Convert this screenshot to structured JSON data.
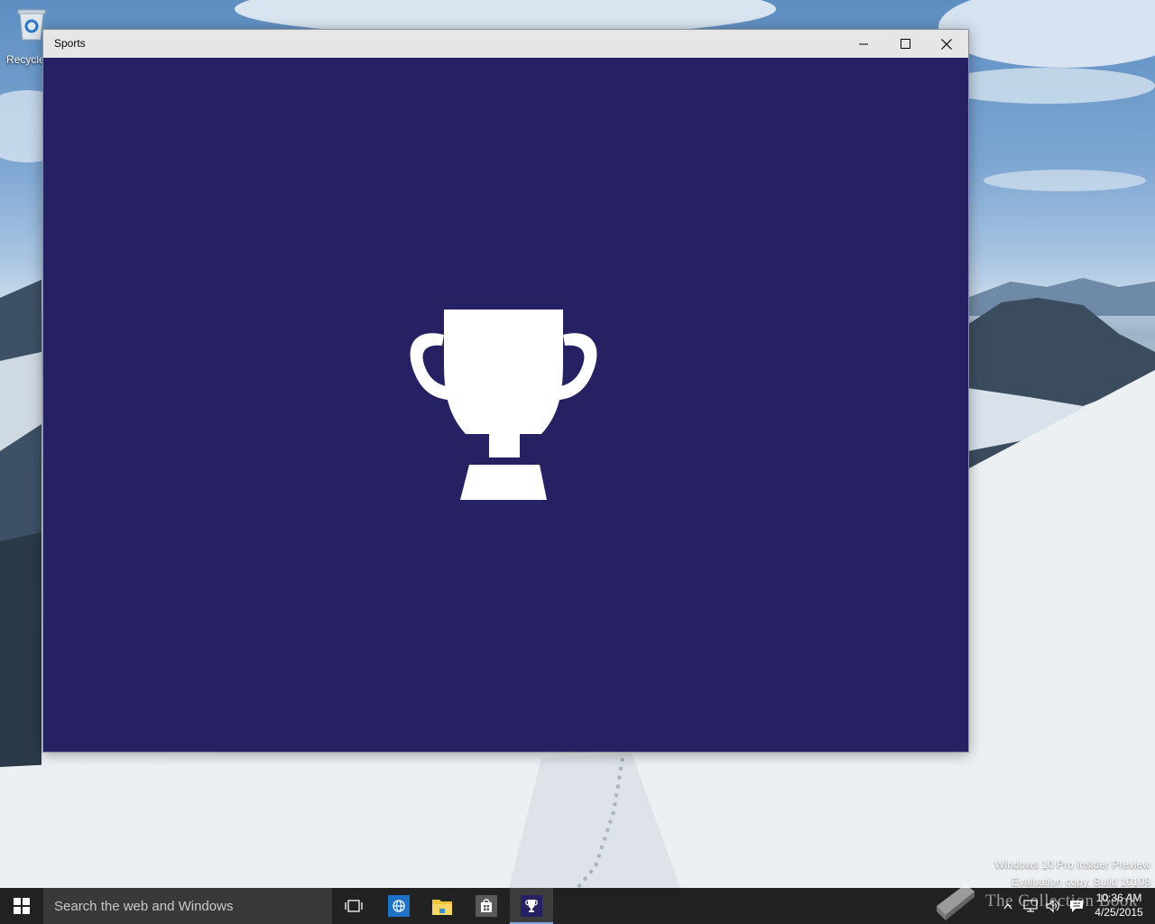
{
  "desktop": {
    "recycle_bin_label": "Recycle Bin",
    "watermark_line1": "Windows 10 Pro Insider Preview",
    "watermark_line2": "Evaluation copy. Build 10108",
    "brand_text": "The Collection Book"
  },
  "window": {
    "title": "Sports",
    "minimize_icon": "minimize-icon",
    "maximize_icon": "maximize-icon",
    "close_icon": "close-icon",
    "splash_color": "#252162",
    "splash_icon": "trophy-icon"
  },
  "taskbar": {
    "search_placeholder": "Search the web and Windows",
    "pinned": [
      "task-view-icon",
      "internet-explorer-icon",
      "file-explorer-icon",
      "store-icon",
      "sports-app-icon"
    ],
    "clock_time": "10:36 AM",
    "clock_date": "4/25/2015",
    "tray": [
      "show-hidden-icons-icon",
      "network-icon",
      "volume-icon",
      "action-center-icon"
    ]
  }
}
